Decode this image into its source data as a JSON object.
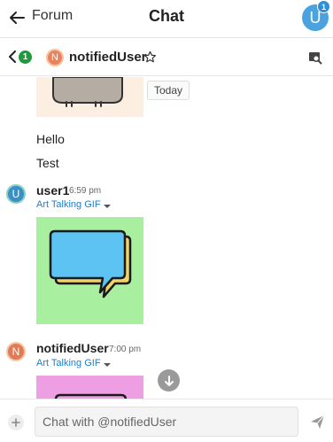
{
  "header": {
    "back_label": "Forum",
    "title": "Chat",
    "user_avatar_letter": "U",
    "notification_count": "1"
  },
  "channel": {
    "unread_count": "1",
    "avatar_letter": "N",
    "name": "notifiedUser"
  },
  "messages": {
    "date_divider": "Today",
    "lines": [
      "Hello",
      "Test"
    ],
    "posts": [
      {
        "avatar_letter": "U",
        "username": "user1",
        "time": "6:59 pm",
        "gif_label": "Art Talking GIF"
      },
      {
        "avatar_letter": "N",
        "username": "notifiedUser",
        "time": "7:00 pm",
        "gif_label": "Art Talking GIF"
      }
    ]
  },
  "composer": {
    "placeholder": "Chat with @notifiedUser"
  },
  "colors": {
    "accent_blue": "#1a7fcf",
    "unread_green": "#1e9b3c",
    "gif_green_bg": "#a8f0a0",
    "gif_pink_bg": "#ee9ee2",
    "gif_cat_bg": "#fcefe1"
  },
  "icons": [
    "back-arrow-icon",
    "chevron-left-icon",
    "star-icon",
    "search-icon",
    "chevron-down-icon",
    "arrow-down-icon",
    "plus-icon",
    "send-icon"
  ]
}
